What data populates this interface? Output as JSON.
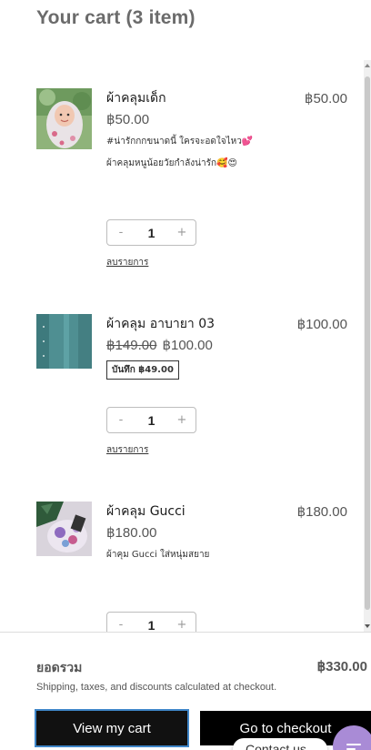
{
  "header": {
    "title": "Your cart (3 item)"
  },
  "items": [
    {
      "name": "ผ้าคลุมเด็ก",
      "price": "฿50.00",
      "line_total": "฿50.00",
      "description": [
        "#น่ารักกกขนาดนี้ ใครจะอดใจไหว💕",
        "ผ้าคลุมหนูน้อยวัยกำลังน่ารัก🥰😍"
      ],
      "quantity": "1",
      "remove_label": "ลบรายการ",
      "thumbnail": "child-hijab-photo"
    },
    {
      "name": "ผ้าคลุม อาบายา 03",
      "original_price": "฿149.00",
      "price": "฿100.00",
      "line_total": "฿100.00",
      "save_badge": "บันทึก ฿49.00",
      "quantity": "1",
      "remove_label": "ลบรายการ",
      "thumbnail": "teal-fabric-photo"
    },
    {
      "name": "ผ้าคลุม Gucci",
      "price": "฿180.00",
      "line_total": "฿180.00",
      "description": [
        "ผ้าคุม Gucci ใส่หนุ่มสยาย"
      ],
      "quantity": "1",
      "thumbnail": "floral-scarf-photo"
    }
  ],
  "qty_controls": {
    "minus": "-",
    "plus": "+"
  },
  "footer": {
    "subtotal_label": "ยอดรวม",
    "subtotal_value": "฿330.00",
    "shipping_note": "Shipping, taxes, and discounts calculated at checkout.",
    "view_cart_label": "View my cart",
    "checkout_label": "Go to checkout",
    "contact_label": "Contact us"
  },
  "colors": {
    "accent_border": "#3f86c8",
    "chat_bubble": "#a98bd6",
    "button_bg": "#111111"
  }
}
